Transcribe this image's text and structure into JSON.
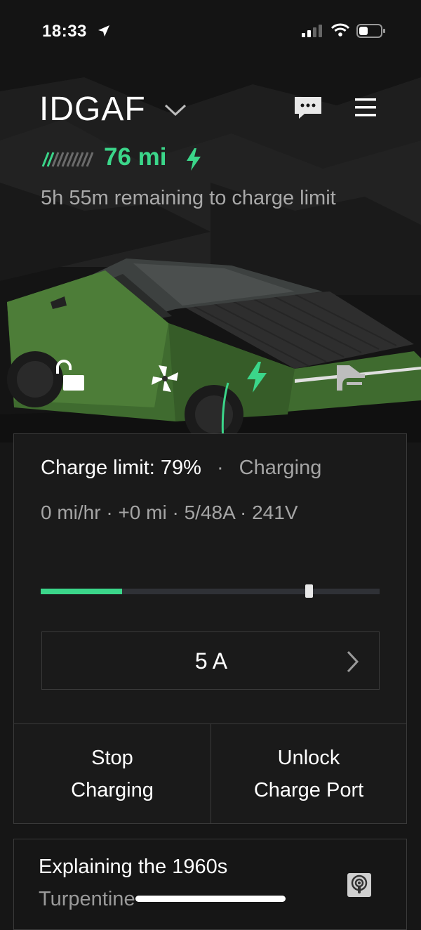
{
  "status_bar": {
    "time": "18:33"
  },
  "header": {
    "vehicle_name": "IDGAF",
    "range": "76 mi",
    "remaining_text": "5h 55m remaining to charge limit"
  },
  "colors": {
    "accent": "#3bd68a",
    "background": "#161616",
    "dim_text": "#a5a5a5"
  },
  "quick_controls": [
    {
      "icon": "lock-open-icon"
    },
    {
      "icon": "fan-icon"
    },
    {
      "icon": "charging-bolt-icon"
    },
    {
      "icon": "tonneau-icon"
    }
  ],
  "charge": {
    "limit_label": "Charge limit: 79%",
    "separator": "·",
    "status": "Charging",
    "details": "0 mi/hr  ·  +0 mi  ·  5/48A  ·  241V",
    "current_level": 0.24,
    "limit_level": 0.79,
    "amps": "5 A",
    "stop_label_1": "Stop",
    "stop_label_2": "Charging",
    "unlock_label_1": "Unlock",
    "unlock_label_2": "Charge Port"
  },
  "media": {
    "title": "Explaining the 1960s",
    "subtitle": "Turpentine"
  }
}
